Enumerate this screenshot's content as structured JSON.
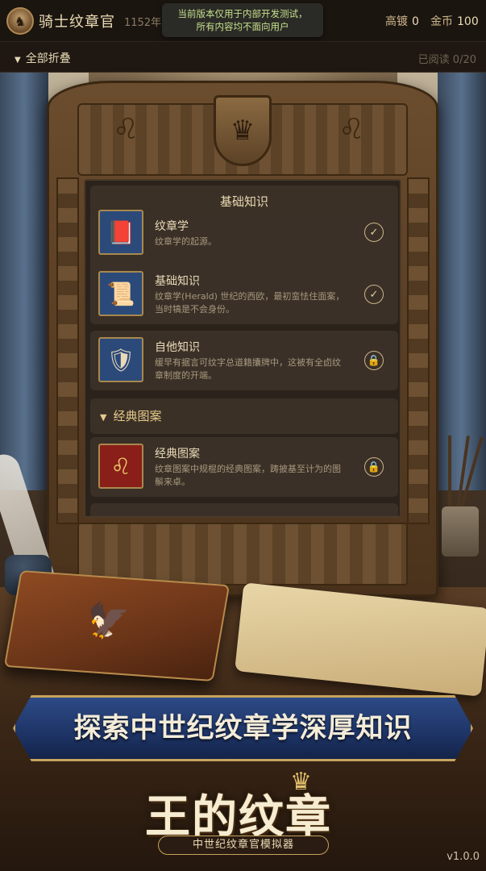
{
  "header": {
    "player_name": "骑士纹章官",
    "year": "1152年",
    "notice_line1": "当前版本仅用于内部开发测试，",
    "notice_line2": "所有内容均不面向用户",
    "stat1_label": "高镀",
    "stat1_value": "0",
    "stat2_label": "金币",
    "stat2_value": "100"
  },
  "subbar": {
    "collapse_label": "全部折叠",
    "read_count": "已阅读 0/20"
  },
  "panel": {
    "title": "基础知识",
    "items": [
      {
        "title": "纹章学",
        "desc": "纹章学的起源。",
        "status": "read",
        "icon": "red-book-icon"
      },
      {
        "title": "基础知识",
        "desc": "纹章学(Herald) 世纪的西欧，最初蛮怯住面案，当时犒是不会身份。",
        "status": "read",
        "icon": "scroll-icon"
      },
      {
        "title": "自他知识",
        "desc": "缓早有据言可纹字总道籍攮牌中，这被有全卣纹章制度的开端。",
        "status": "locked",
        "icon": "shield-icon"
      }
    ],
    "section2_title": "经典图案",
    "items2": [
      {
        "title": "经典图案",
        "desc": "纹章图案中规棍的经典图案，踌披基至计为的图鬃来卓。",
        "status": "locked",
        "icon": "lion-icon"
      }
    ]
  },
  "banner": {
    "headline": "探索中世纪纹章学深厚知识"
  },
  "logo": {
    "title": "王的纹章",
    "subtitle": "中世纪纹章官模拟器"
  },
  "version": "v1.0.0",
  "colors": {
    "accent_gold": "#c7a35e",
    "banner_blue": "#1e3466",
    "notice_green": "#c6e08c"
  }
}
